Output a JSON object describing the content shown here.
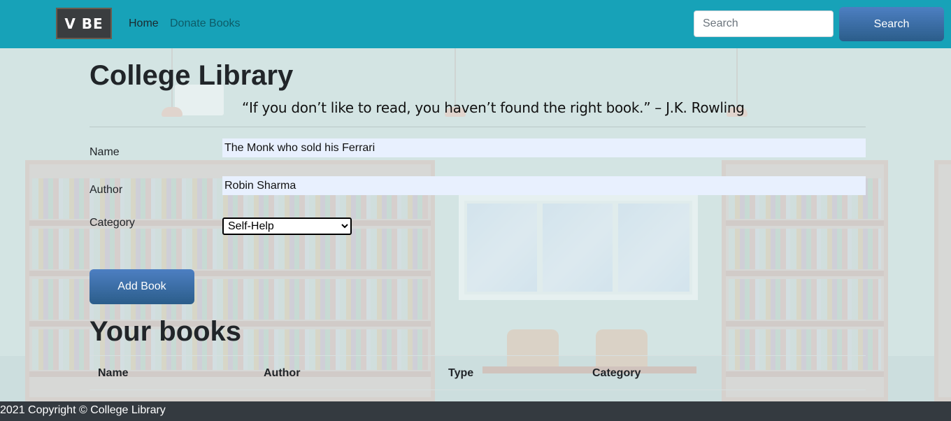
{
  "navbar": {
    "logo_text": "V BE",
    "links": [
      {
        "label": "Home"
      },
      {
        "label": "Donate Books"
      }
    ],
    "search": {
      "placeholder": "Search",
      "button_label": "Search"
    }
  },
  "main": {
    "title": "College Library",
    "quote": "“If you don’t like to read, you haven’t found the right book.” – J.K. Rowling",
    "form": {
      "name_label": "Name",
      "name_value": "The Monk who sold his Ferrari",
      "author_label": "Author",
      "author_value": "Robin Sharma",
      "category_label": "Category",
      "category_selected": "Self-Help",
      "add_button": "Add Book"
    },
    "books": {
      "title": "Your books",
      "columns": [
        "Name",
        "Author",
        "Type",
        "Category"
      ]
    }
  },
  "footer": {
    "text": "2021 Copyright © College Library"
  },
  "colors": {
    "navbar_bg": "#17a2b8",
    "button_gradient_top": "#4d7fc2",
    "button_gradient_bottom": "#2b5d8a",
    "footer_bg": "#343a40",
    "input_autofill_bg": "#e8f0fe"
  }
}
